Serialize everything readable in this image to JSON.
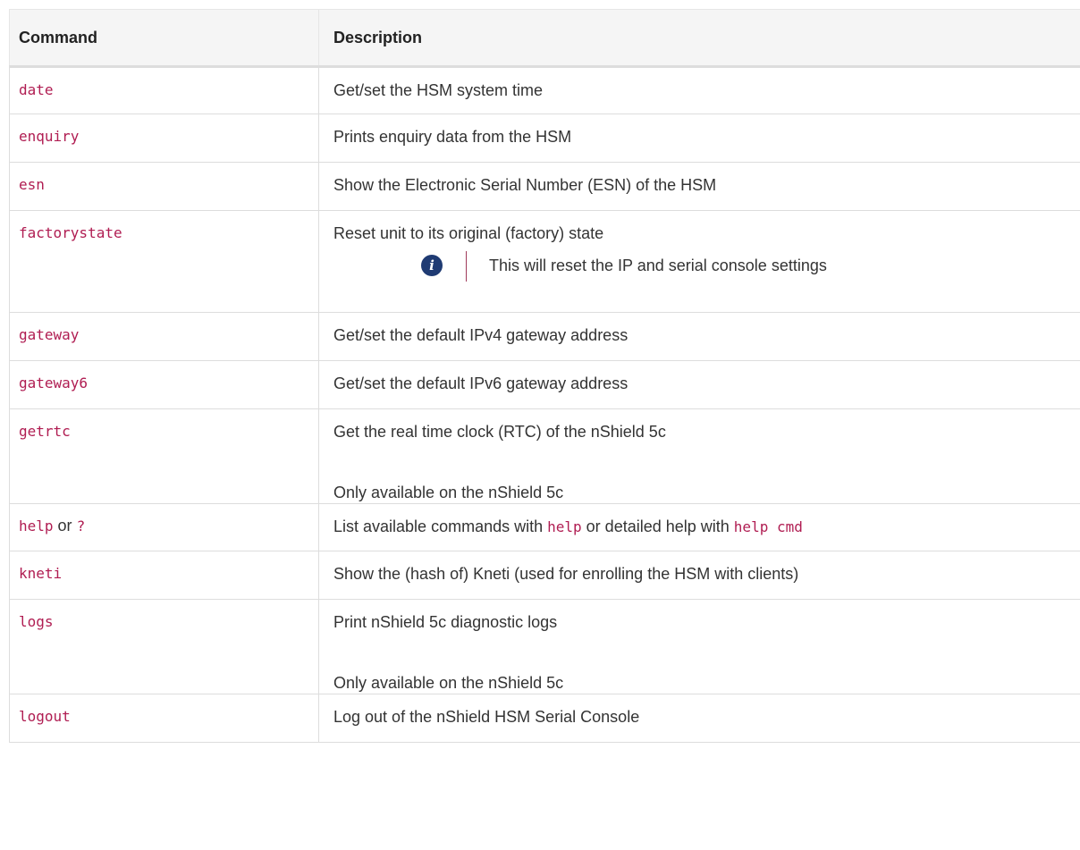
{
  "table": {
    "headers": {
      "command": "Command",
      "description": "Description"
    },
    "rows": [
      {
        "command": "date",
        "description": "Get/set the HSM system time"
      },
      {
        "command": "enquiry",
        "description": "Prints enquiry data from the HSM"
      },
      {
        "command": "esn",
        "description": "Show the Electronic Serial Number (ESN) of the HSM"
      },
      {
        "command": "factorystate",
        "description": "Reset unit to its original (factory) state",
        "note": "This will reset the IP and serial console settings",
        "note_icon": "info-icon"
      },
      {
        "command": "gateway",
        "description": "Get/set the default IPv4 gateway address"
      },
      {
        "command": "gateway6",
        "description": "Get/set the default IPv6 gateway address"
      },
      {
        "command": "getrtc",
        "description": "Get the real time clock (RTC) of the nShield 5c",
        "extra": "Only available on the nShield 5c"
      },
      {
        "command": "help",
        "command_or": "or",
        "command_alt": "?",
        "description_parts": [
          "List available commands with",
          "help",
          "or detailed help with",
          "help cmd"
        ]
      },
      {
        "command": "kneti",
        "description": "Show the (hash of) Kneti (used for enrolling the HSM with clients)"
      },
      {
        "command": "logs",
        "description": "Print nShield 5c diagnostic logs",
        "extra": "Only available on the nShield 5c"
      },
      {
        "command": "logout",
        "description": "Log out of the nShield HSM Serial Console"
      }
    ]
  },
  "colors": {
    "command": "#b01d52",
    "header_bg": "#f5f5f5",
    "info_icon": "#1f3b73",
    "note_bar": "#a03a5a"
  }
}
